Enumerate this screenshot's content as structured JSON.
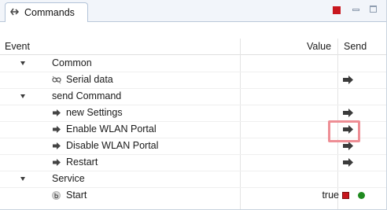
{
  "view": {
    "tab_label": "Commands",
    "tab_icon": "commands-view-icon",
    "toolbar": {
      "stop_color": "#c8171e"
    }
  },
  "table": {
    "columns": {
      "event": "Event",
      "value": "Value",
      "send": "Send"
    },
    "groups": [
      {
        "label": "Common",
        "items": [
          {
            "label": "Serial data",
            "icon": "serial-data-icon"
          }
        ]
      },
      {
        "label": "send Command",
        "items": [
          {
            "label": "new Settings",
            "icon": "command-arrow-icon"
          },
          {
            "label": "Enable WLAN Portal",
            "icon": "command-arrow-icon"
          },
          {
            "label": "Disable WLAN Portal",
            "icon": "command-arrow-icon"
          },
          {
            "label": "Restart",
            "icon": "command-arrow-icon"
          }
        ]
      },
      {
        "label": "Service",
        "items": [
          {
            "label": "Start",
            "icon": "service-b-icon",
            "value": "true"
          }
        ]
      }
    ]
  },
  "colors": {
    "highlight": "#ee8e95",
    "stopped": "#c8171e",
    "running": "#1f8a1f"
  }
}
